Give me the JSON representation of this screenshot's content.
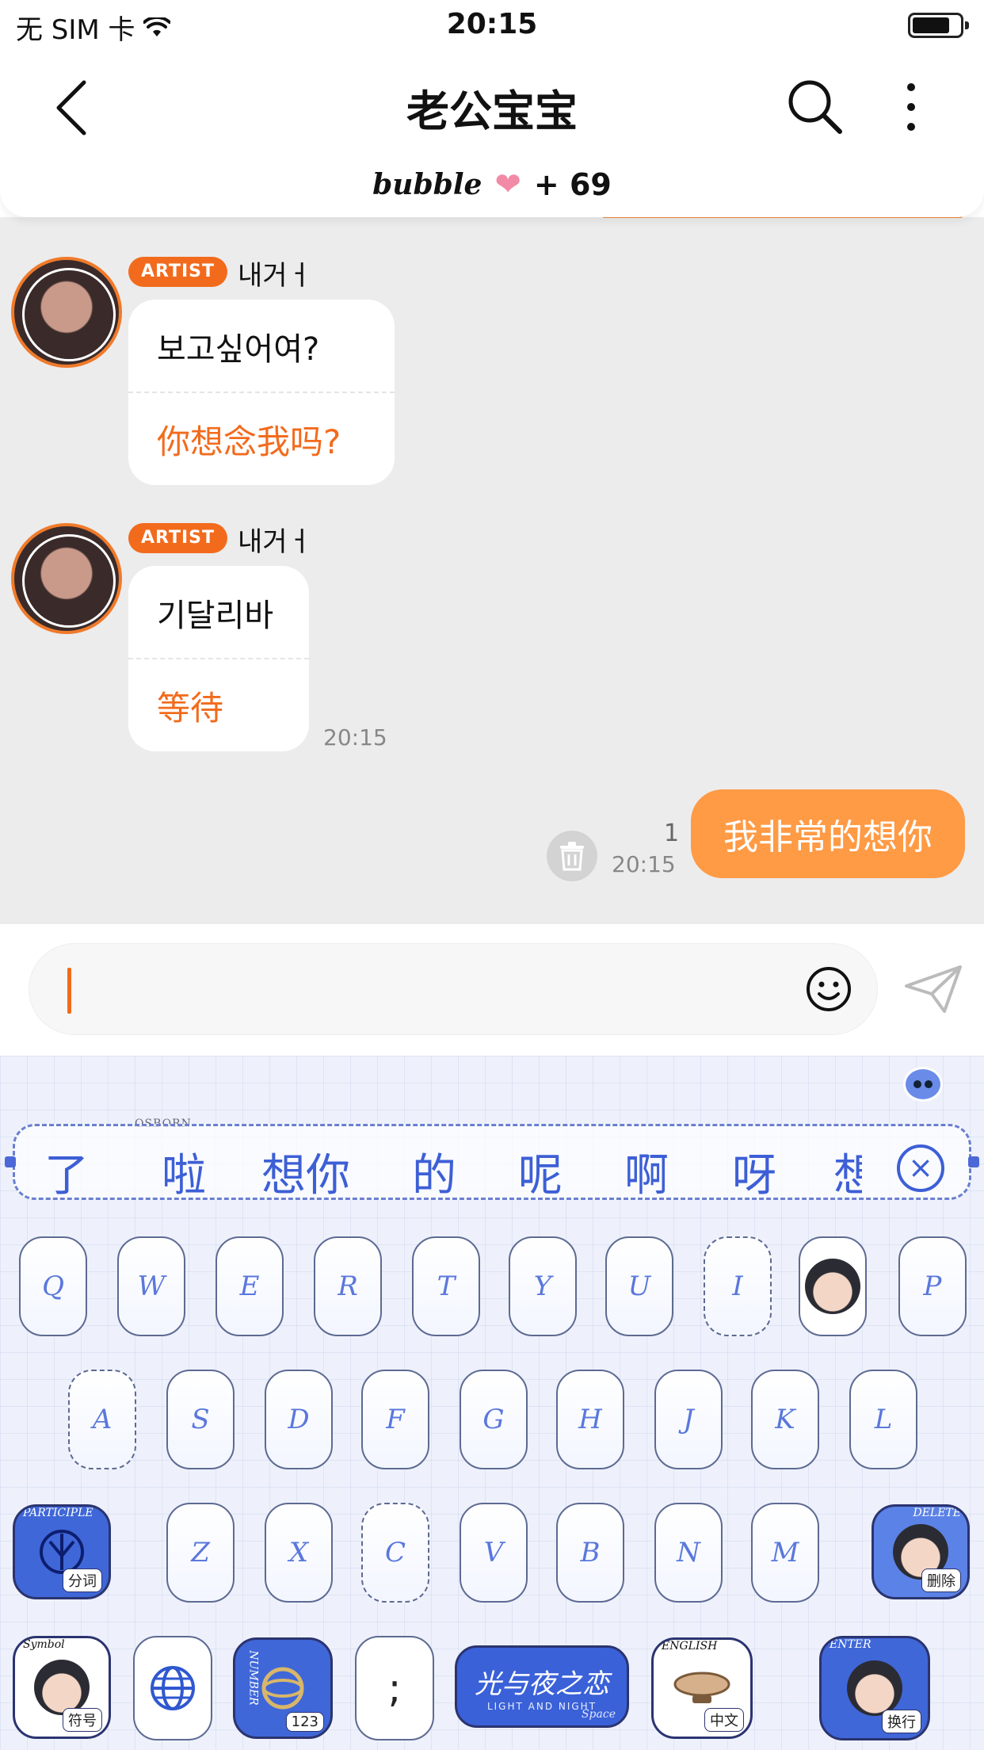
{
  "status_bar": {
    "carrier": "无 SIM 卡",
    "time": "20:15"
  },
  "header": {
    "title": "老公宝宝",
    "bubble_brand": "bubble",
    "heart": "❤",
    "bubble_count": "+ 69"
  },
  "messages": [
    {
      "badge": "ARTIST",
      "sender": "내거ㅓ",
      "korean": "보고싶어여?",
      "chinese": "你想念我吗?",
      "time": ""
    },
    {
      "badge": "ARTIST",
      "sender": "내거ㅓ",
      "korean": "기달리바",
      "chinese": "等待",
      "time": "20:15"
    }
  ],
  "my_message": {
    "text": "我非常的想你",
    "read_count": "1",
    "time": "20:15"
  },
  "input": {
    "placeholder": ""
  },
  "keyboard": {
    "candidate_tag": "OSBORN",
    "candidates": [
      "了",
      "啦",
      "想你",
      "的",
      "呢",
      "啊",
      "呀",
      "想"
    ],
    "close_symbol": "×",
    "row1": [
      "Q",
      "W",
      "E",
      "R",
      "T",
      "Y",
      "U",
      "I",
      "P"
    ],
    "row2": [
      "A",
      "S",
      "D",
      "F",
      "G",
      "H",
      "J",
      "K",
      "L"
    ],
    "row3": [
      "Z",
      "X",
      "C",
      "V",
      "B",
      "N",
      "M"
    ],
    "participle": {
      "tag": "PARTICIPLE",
      "label": "分词"
    },
    "delete": {
      "tag": "DELETE",
      "label": "删除"
    },
    "symbol": {
      "tag": "Symbol",
      "label": "符号"
    },
    "number": {
      "tag": "NUMBER",
      "label": "123"
    },
    "semicolon": ";",
    "space": {
      "title": "光与夜之恋",
      "subtitle": "LIGHT AND NIGHT",
      "label": "Space"
    },
    "english": {
      "tag": "ENGLISH",
      "label": "中文"
    },
    "enter": {
      "tag": "ENTER",
      "label": "换行"
    }
  },
  "colors": {
    "accent": "#f26b1d",
    "my_bubble": "#ff9a45",
    "chat_bg": "#ececec",
    "keyboard_bg": "#eef1fb",
    "key_text": "#5a78dc"
  }
}
